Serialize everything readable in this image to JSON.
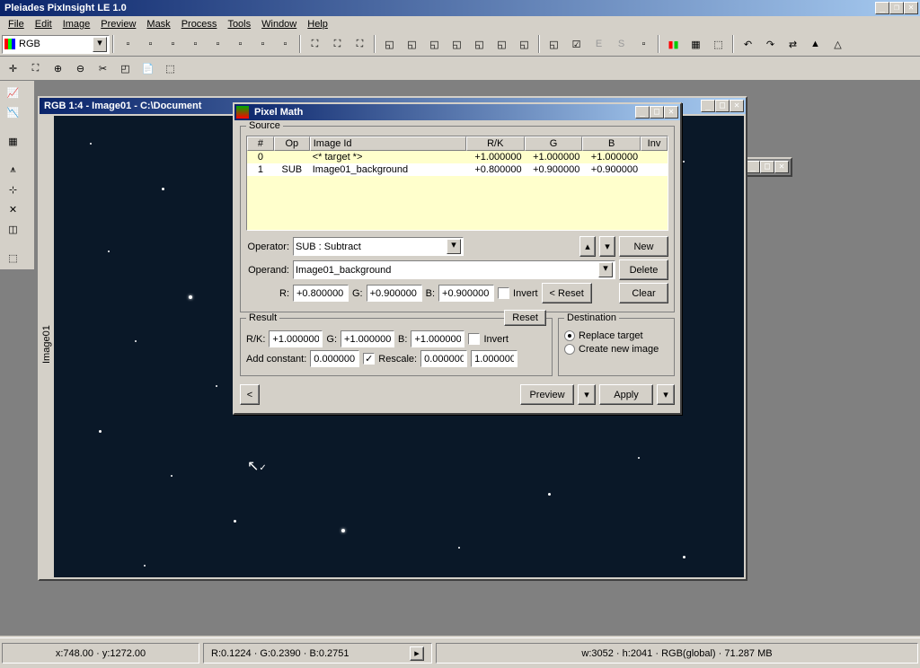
{
  "app": {
    "title": "Pleiades PixInsight LE 1.0"
  },
  "menu": [
    "File",
    "Edit",
    "Image",
    "Preview",
    "Mask",
    "Process",
    "Tools",
    "Window",
    "Help"
  ],
  "combo": {
    "value": "RGB"
  },
  "imagewin": {
    "title": "RGB 1:4 - Image01 - C:\\Document",
    "tab": "Image01"
  },
  "secondwin": {
    "visible": true
  },
  "pixelmath": {
    "title": "Pixel Math",
    "source": {
      "label": "Source",
      "headers": {
        "num": "#",
        "op": "Op",
        "imageid": "Image Id",
        "rk": "R/K",
        "g": "G",
        "b": "B",
        "inv": "Inv"
      },
      "rows": [
        {
          "num": "0",
          "op": "",
          "imageid": "<* target *>",
          "rk": "+1.000000",
          "g": "+1.000000",
          "b": "+1.000000"
        },
        {
          "num": "1",
          "op": "SUB",
          "imageid": "Image01_background",
          "rk": "+0.800000",
          "g": "+0.900000",
          "b": "+0.900000"
        }
      ],
      "operator_label": "Operator:",
      "operator": "SUB : Subtract",
      "operand_label": "Operand:",
      "operand": "Image01_background",
      "r_label": "R:",
      "r": "+0.800000",
      "g_label": "G:",
      "g": "+0.900000",
      "b_label": "B:",
      "b": "+0.900000",
      "invert": "Invert",
      "reset": "< Reset",
      "new": "New",
      "delete": "Delete",
      "clear": "Clear"
    },
    "result": {
      "label": "Result",
      "reset": "Reset",
      "rk_label": "R/K:",
      "rk": "+1.000000",
      "g_label": "G:",
      "g": "+1.000000",
      "b_label": "B:",
      "b": "+1.000000",
      "invert": "Invert",
      "addconst_label": "Add constant:",
      "addconst": "0.000000",
      "rescale": "Rescale:",
      "rescale_lo": "0.000000",
      "rescale_hi": "1.000000"
    },
    "dest": {
      "label": "Destination",
      "replace": "Replace target",
      "create": "Create new image"
    },
    "preview": "Preview",
    "apply": "Apply",
    "back": "<"
  },
  "status": {
    "coords": "x:748.00 · y:1272.00",
    "rgb": "R:0.1224 · G:0.2390 · B:0.2751",
    "size": "w:3052 · h:2041 · RGB(global) · 71.287 MB"
  }
}
